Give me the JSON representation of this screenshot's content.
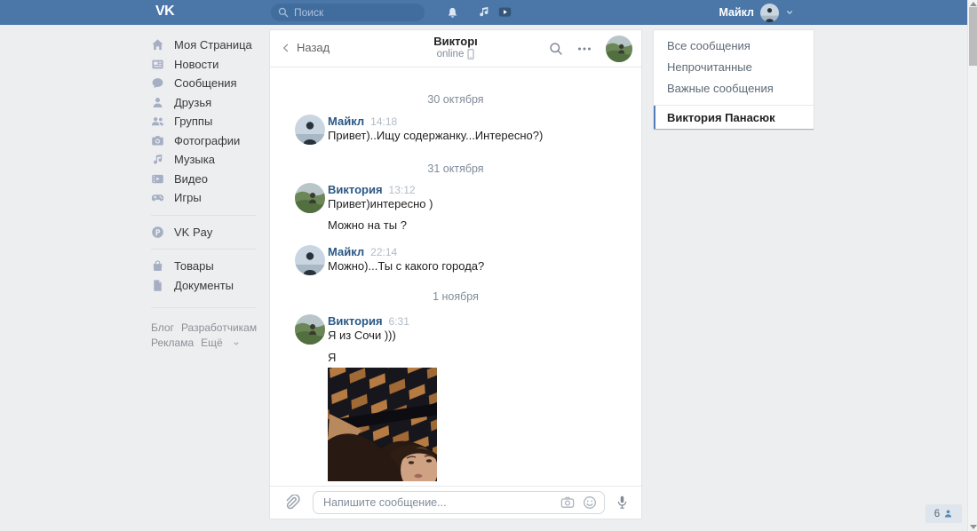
{
  "colors": {
    "brand": "#4a76a8",
    "link": "#2a5885",
    "selected_bar": "#5181b8",
    "page_bg": "#edeef0"
  },
  "topbar": {
    "logo": "VK",
    "search_placeholder": "Поиск",
    "user_name": "Майкл"
  },
  "sidebar": {
    "items": [
      {
        "label": "Моя Страница",
        "icon": "home-icon"
      },
      {
        "label": "Новости",
        "icon": "news-icon"
      },
      {
        "label": "Сообщения",
        "icon": "messages-icon"
      },
      {
        "label": "Друзья",
        "icon": "friends-icon"
      },
      {
        "label": "Группы",
        "icon": "groups-icon"
      },
      {
        "label": "Фотографии",
        "icon": "camera-icon"
      },
      {
        "label": "Музыка",
        "icon": "music-note-icon"
      },
      {
        "label": "Видео",
        "icon": "video-icon"
      },
      {
        "label": "Игры",
        "icon": "gamepad-icon"
      }
    ],
    "vkpay_label": "VK Pay",
    "extra_items": [
      {
        "label": "Товары",
        "icon": "shopping-bag-icon"
      },
      {
        "label": "Документы",
        "icon": "document-icon"
      }
    ],
    "footer_links": [
      "Блог",
      "Разработчикам",
      "Реклама",
      "Ещё"
    ]
  },
  "chat": {
    "back_label": "Назад",
    "title": "Викторı",
    "status": "online",
    "days": [
      {
        "date": "30 октября",
        "messages": [
          {
            "author": "Майкл",
            "time": "14:18",
            "lines": [
              "Привет)..Ищу содержанку...Интересно?)"
            ]
          }
        ]
      },
      {
        "date": "31 октября",
        "messages": [
          {
            "author": "Виктория",
            "time": "13:12",
            "lines": [
              "Привет)интересно )",
              "Можно на ты ?"
            ]
          },
          {
            "author": "Майкл",
            "time": "22:14",
            "lines": [
              "Можно)...Ты с какого города?"
            ]
          }
        ]
      },
      {
        "date": "1 ноября",
        "messages": [
          {
            "author": "Виктория",
            "time": "6:31",
            "lines": [
              "Я из Сочи )))",
              "Я"
            ],
            "attachment": "photo"
          }
        ]
      }
    ],
    "composer_placeholder": "Напишите сообщение..."
  },
  "messages_panel": {
    "filters": [
      "Все сообщения",
      "Непрочитанные",
      "Важные сообщения"
    ],
    "selected_dialog": "Виктория Панасюк"
  },
  "status_bar": {
    "online_friends_count": "6"
  },
  "icons": [
    "search-icon",
    "bell-icon",
    "music-note-icon",
    "video-icon",
    "chevron-down-icon",
    "chevron-left-icon",
    "ellipsis-icon",
    "mobile-phone-icon",
    "paperclip-icon",
    "camera-icon",
    "smiley-icon",
    "microphone-icon",
    "person-icon"
  ]
}
